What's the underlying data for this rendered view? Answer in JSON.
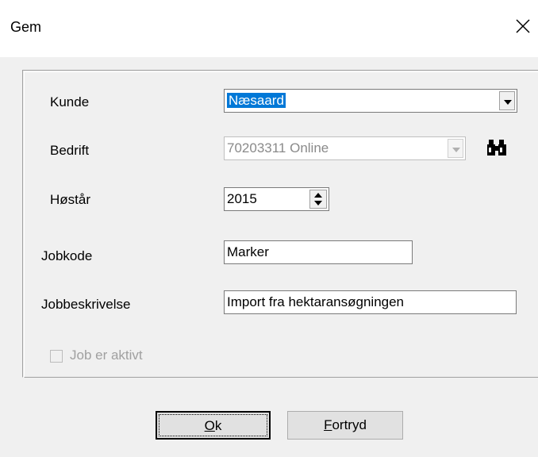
{
  "window": {
    "title": "Gem"
  },
  "form": {
    "kunde_label": "Kunde",
    "kunde_value": "Næsaard",
    "bedrift_label": "Bedrift",
    "bedrift_value": "70203311 Online",
    "hoestaar_label": "Høstår",
    "hoestaar_value": "2015",
    "jobkode_label": "Jobkode",
    "jobkode_value": "Marker",
    "jobbeskrivelse_label": "Jobbeskrivelse",
    "jobbeskrivelse_value": "Import fra hektaransøgningen",
    "job_aktivt_label": "Job er aktivt",
    "job_aktivt_checked": false
  },
  "buttons": {
    "ok_accel": "O",
    "ok_rest": "k",
    "cancel_accel": "F",
    "cancel_rest": "ortryd"
  },
  "icons": {
    "close": "close-icon",
    "search": "binoculars-icon"
  }
}
